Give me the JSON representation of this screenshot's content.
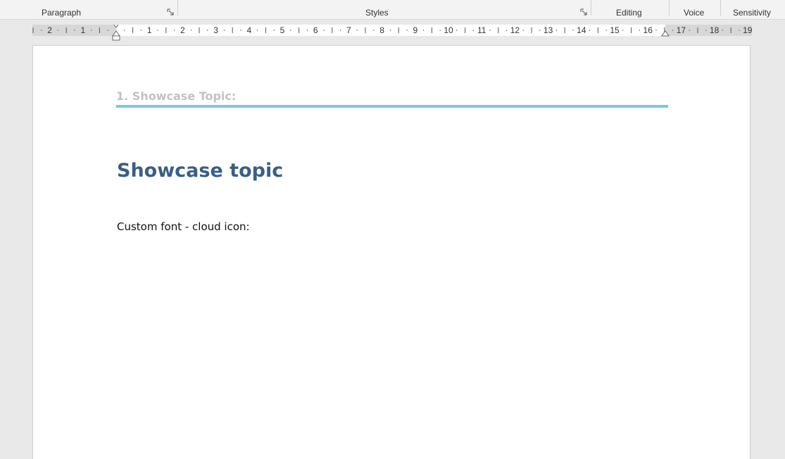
{
  "ribbon": {
    "groups": {
      "paragraph": "Paragraph",
      "styles": "Styles",
      "editing": "Editing",
      "voice": "Voice",
      "sensitivity": "Sensitivity"
    },
    "launcher_glyph": "↘"
  },
  "ruler": {
    "left_numbers": [
      "2",
      "1"
    ],
    "right_numbers": [
      "1",
      "2",
      "3",
      "4",
      "5",
      "6",
      "7",
      "8",
      "9",
      "10",
      "11",
      "12",
      "13",
      "14",
      "15",
      "16",
      "17",
      "18",
      "19"
    ]
  },
  "document": {
    "header_text": "1. Showcase Topic:",
    "title": "Showcase topic",
    "body_text": "Custom font - cloud icon:"
  },
  "colors": {
    "header_rule": "#7ec8dd",
    "title": "#3a5f86",
    "header_text": "#c2c2c2"
  }
}
